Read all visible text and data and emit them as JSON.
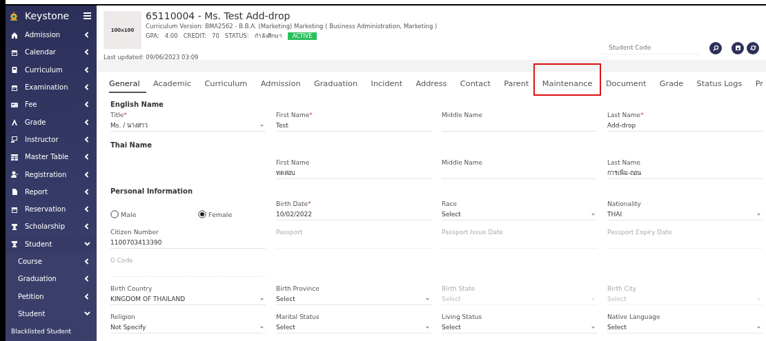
{
  "sidebar": {
    "brand": "Keystone",
    "items": [
      {
        "label": "Admission",
        "expanded": false
      },
      {
        "label": "Calendar",
        "expanded": false
      },
      {
        "label": "Curriculum",
        "expanded": false
      },
      {
        "label": "Examination",
        "expanded": false
      },
      {
        "label": "Fee",
        "expanded": false
      },
      {
        "label": "Grade",
        "expanded": false
      },
      {
        "label": "Instructor",
        "expanded": false
      },
      {
        "label": "Master Table",
        "expanded": false
      },
      {
        "label": "Registration",
        "expanded": false
      },
      {
        "label": "Report",
        "expanded": false
      },
      {
        "label": "Reservation",
        "expanded": false
      },
      {
        "label": "Scholarship",
        "expanded": false
      },
      {
        "label": "Student",
        "expanded": true,
        "children": [
          {
            "label": "Course",
            "expanded": false
          },
          {
            "label": "Graduation",
            "expanded": false
          },
          {
            "label": "Petition",
            "expanded": false
          },
          {
            "label": "Student",
            "expanded": true,
            "children": [
              {
                "label": "Blacklisted Student"
              }
            ]
          }
        ]
      }
    ]
  },
  "header": {
    "photo_placeholder": "100x100",
    "title": "65110004 - Ms. Test Add-drop",
    "curriculum": "Curriculum Version: BMA2562 - B.B.A. (Marketing) Marketing ( Business Administration, Marketing )",
    "stats": [
      {
        "label": "GPA:",
        "value": "4.00"
      },
      {
        "label": "CREDIT:",
        "value": "70"
      },
      {
        "label": "STATUS:",
        "value": "กำลังศึกษา"
      }
    ],
    "status_badge": "ACTIVE",
    "last_updated": "Last updated: 09/06/2023 03:09",
    "search": {
      "placeholder": "Student Code"
    }
  },
  "tabs": [
    {
      "label": "General",
      "selected": true,
      "highlighted": false
    },
    {
      "label": "Academic",
      "selected": false,
      "highlighted": false
    },
    {
      "label": "Curriculum",
      "selected": false,
      "highlighted": false
    },
    {
      "label": "Admission",
      "selected": false,
      "highlighted": false
    },
    {
      "label": "Graduation",
      "selected": false,
      "highlighted": false
    },
    {
      "label": "Incident",
      "selected": false,
      "highlighted": false
    },
    {
      "label": "Address",
      "selected": false,
      "highlighted": false
    },
    {
      "label": "Contact",
      "selected": false,
      "highlighted": false
    },
    {
      "label": "Parent",
      "selected": false,
      "highlighted": false
    },
    {
      "label": "Maintenance",
      "selected": false,
      "highlighted": true
    },
    {
      "label": "Document",
      "selected": false,
      "highlighted": false
    },
    {
      "label": "Grade",
      "selected": false,
      "highlighted": false
    },
    {
      "label": "Status Logs",
      "selected": false,
      "highlighted": false
    },
    {
      "label": "Pr",
      "selected": false,
      "highlighted": false
    }
  ],
  "sections": [
    {
      "heading": "English Name",
      "rows": [
        [
          {
            "kind": "select",
            "label": "Title",
            "required_mark": "*",
            "value": "Ms. / นางสาว",
            "disabled": false
          },
          {
            "kind": "text",
            "label": "First Name",
            "required_mark": "*",
            "value": "Test",
            "disabled": false
          },
          {
            "kind": "text",
            "label": "Middle Name",
            "disabled": false
          },
          {
            "kind": "text",
            "label": "Last Name",
            "required_mark": "*",
            "value": "Add-drop",
            "disabled": false
          }
        ]
      ]
    },
    {
      "heading": "Thai Name",
      "rows": [
        [
          {
            "kind": "empty"
          },
          {
            "kind": "text",
            "label": "First Name",
            "value": "ทดสอบ",
            "disabled": false
          },
          {
            "kind": "text",
            "label": "Middle Name",
            "disabled": false
          },
          {
            "kind": "text",
            "label": "Last Name",
            "value": "การเพิ่ม-ถอน",
            "disabled": false
          }
        ]
      ]
    },
    {
      "heading": "Personal Information",
      "rows": [
        [
          {
            "kind": "radio",
            "options": [
              {
                "label": "Male",
                "selected": false
              },
              {
                "label": "Female",
                "selected": true
              }
            ]
          },
          {
            "kind": "text",
            "label": "Birth Date",
            "required_mark": "*",
            "value": "10/02/2022",
            "disabled": false
          },
          {
            "kind": "select",
            "label": "Race",
            "value": "Select",
            "disabled": false
          },
          {
            "kind": "select",
            "label": "Nationality",
            "value": "THAI",
            "disabled": false
          }
        ],
        [
          {
            "kind": "text",
            "label": "Citizen Number",
            "value": "1100703413390",
            "disabled": false
          },
          {
            "kind": "text",
            "label": "Passport",
            "disabled": true
          },
          {
            "kind": "text",
            "label": "Passport Issue Date",
            "disabled": true
          },
          {
            "kind": "text",
            "label": "Passport Expiry Date",
            "disabled": true
          }
        ],
        [
          {
            "kind": "text",
            "label": "G Code",
            "disabled": true
          },
          {
            "kind": "empty"
          },
          {
            "kind": "empty"
          },
          {
            "kind": "empty"
          }
        ],
        [
          {
            "kind": "select",
            "label": "Birth Country",
            "value": "KINGDOM OF THAILAND",
            "disabled": false
          },
          {
            "kind": "select",
            "label": "Birth Province",
            "value": "Select",
            "disabled": false
          },
          {
            "kind": "select",
            "label": "Birth State",
            "placeholder": "Select",
            "disabled": true
          },
          {
            "kind": "select",
            "label": "Birth City",
            "placeholder": "Select",
            "disabled": true
          }
        ],
        [
          {
            "kind": "select",
            "label": "Religion",
            "value": "Not Specify",
            "disabled": false
          },
          {
            "kind": "select",
            "label": "Marital Status",
            "value": "Select",
            "disabled": false
          },
          {
            "kind": "select",
            "label": "Living Status",
            "value": "Select",
            "disabled": false
          },
          {
            "kind": "select",
            "label": "Native Language",
            "value": "Select",
            "disabled": false
          }
        ]
      ]
    }
  ]
}
